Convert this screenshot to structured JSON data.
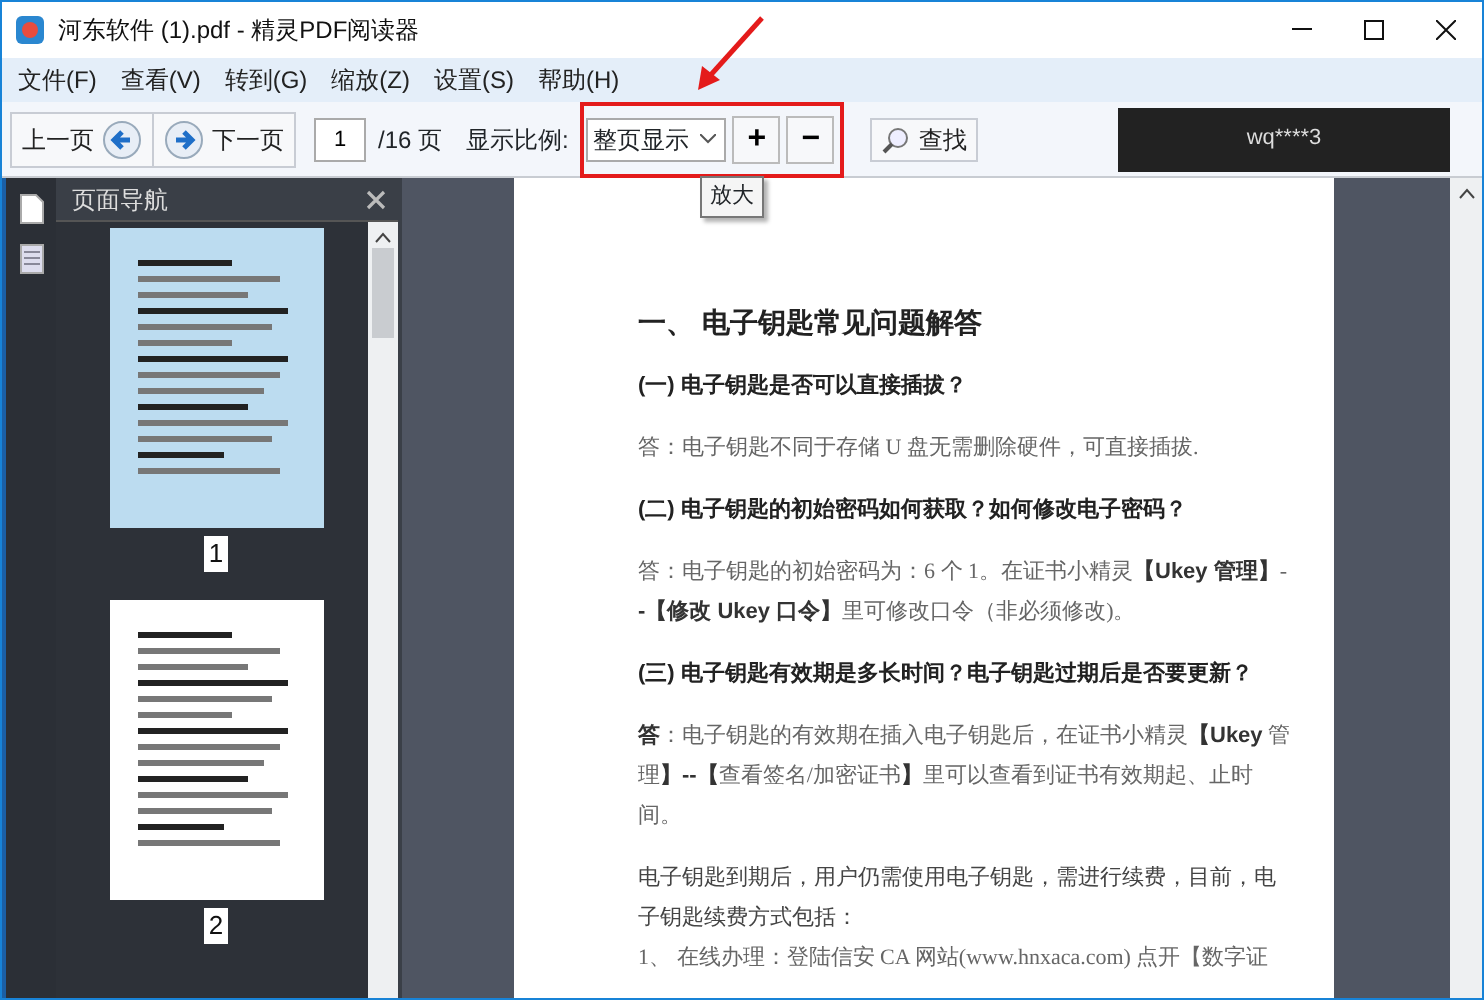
{
  "window": {
    "title": "河东软件 (1).pdf - 精灵PDF阅读器"
  },
  "menu": [
    {
      "label": "文件(F)"
    },
    {
      "label": "查看(V)"
    },
    {
      "label": "转到(G)"
    },
    {
      "label": "缩放(Z)"
    },
    {
      "label": "设置(S)"
    },
    {
      "label": "帮助(H)"
    }
  ],
  "toolbar": {
    "prev_label": "上一页",
    "next_label": "下一页",
    "page_value": "1",
    "page_total": "/16 页",
    "zoom_label": "显示比例:",
    "zoom_value": "整页显示",
    "zoom_in": "+",
    "zoom_out": "−",
    "find_label": "查找",
    "tooltip": "放大"
  },
  "ad": {
    "text": "wq****3"
  },
  "sidebar": {
    "title": "页面导航",
    "thumbnails": [
      {
        "label": "1",
        "selected": true
      },
      {
        "label": "2",
        "selected": false
      }
    ]
  },
  "document": {
    "blocks": [
      {
        "kind": "heading",
        "lines": [
          "一、 电子钥匙常见问题解答"
        ]
      },
      {
        "kind": "question",
        "lines": [
          "(一) 电子钥匙是否可以直接插拔？"
        ]
      },
      {
        "kind": "answer",
        "lines": [
          "答：电子钥匙不同于存储 U 盘无需删除硬件，可直接插拔."
        ]
      },
      {
        "kind": "question",
        "lines": [
          "(二) 电子钥匙的初始密码如何获取？如何修改电子密码？"
        ]
      },
      {
        "kind": "answer",
        "lines": [
          "答：电子钥匙的初始密码为：6 个 1。在证书小精灵**【Ukey 管理】**-",
          "**-【修改 Ukey 口令】**里可修改口令（非必须修改)。"
        ]
      },
      {
        "kind": "question",
        "lines": [
          "(三) 电子钥匙有效期是多长时间？电子钥匙过期后是否要更新？"
        ]
      },
      {
        "kind": "answer",
        "lines": [
          "**答**：电子钥匙的有效期在插入电子钥匙后，在证书小精灵**【Ukey** 管",
          "理**】--【**查看签名/加密证书**】**里可以查看到证书有效期起、止时",
          "间。"
        ]
      },
      {
        "kind": "paragraph",
        "lines": [
          "电子钥匙到期后，用户仍需使用电子钥匙，需进行续费，目前，电",
          "子钥匙续费方式包括："
        ]
      },
      {
        "kind": "list",
        "lines": [
          "1、    在线办理：登陆信安 CA 网站(www.hnxaca.com) 点开【数字证"
        ]
      }
    ]
  }
}
